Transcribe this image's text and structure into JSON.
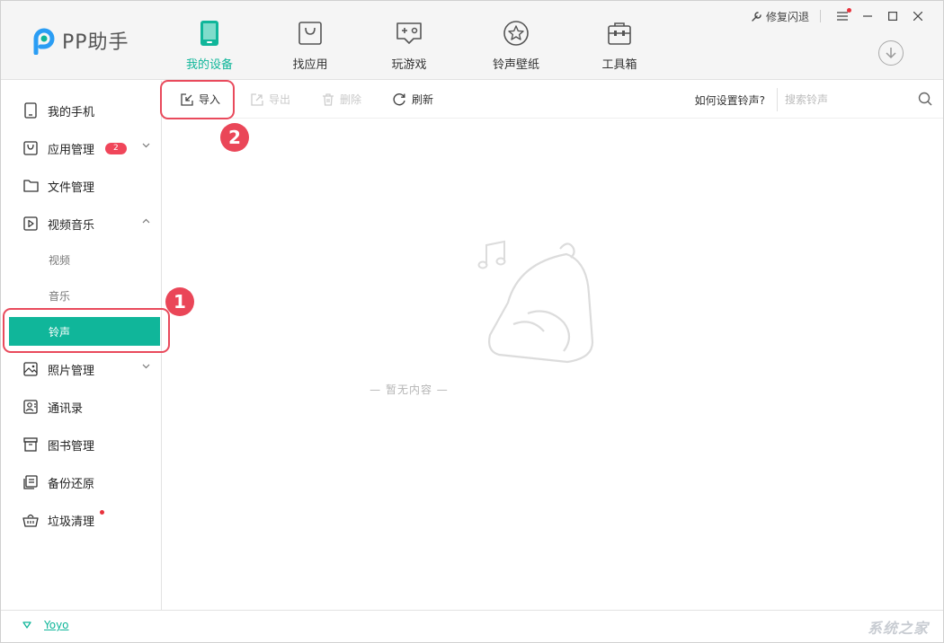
{
  "app": {
    "logo_text": "PP助手",
    "accent_color": "#10b69a"
  },
  "nav": {
    "items": [
      {
        "label": "我的设备",
        "icon": "phone-icon",
        "active": true
      },
      {
        "label": "找应用",
        "icon": "shopping-bag-icon",
        "active": false
      },
      {
        "label": "玩游戏",
        "icon": "gamepad-icon",
        "active": false
      },
      {
        "label": "铃声壁纸",
        "icon": "star-icon",
        "active": false
      },
      {
        "label": "工具箱",
        "icon": "toolbox-icon",
        "active": false
      }
    ]
  },
  "window": {
    "repair_label": "修复闪退"
  },
  "sidebar": {
    "items": [
      {
        "label": "我的手机",
        "icon": "phone-outline-icon"
      },
      {
        "label": "应用管理",
        "icon": "bag-outline-icon",
        "badge": "2"
      },
      {
        "label": "文件管理",
        "icon": "folder-icon"
      },
      {
        "label": "视频音乐",
        "icon": "play-icon"
      },
      {
        "label": "照片管理",
        "icon": "image-icon"
      },
      {
        "label": "通讯录",
        "icon": "contacts-icon"
      },
      {
        "label": "图书管理",
        "icon": "book-icon"
      },
      {
        "label": "备份还原",
        "icon": "backup-icon"
      },
      {
        "label": "垃圾清理",
        "icon": "basket-icon"
      }
    ],
    "sub_items": [
      {
        "label": "视频"
      },
      {
        "label": "音乐"
      },
      {
        "label": "铃声",
        "active": true
      }
    ]
  },
  "toolbar": {
    "import_label": "导入",
    "export_label": "导出",
    "delete_label": "删除",
    "refresh_label": "刷新",
    "help_label": "如何设置铃声?",
    "search_placeholder": "搜索铃声"
  },
  "content": {
    "empty_text": "— 暂无内容 —"
  },
  "footer": {
    "device_name": "Yoyo",
    "watermark": "系统之家"
  },
  "annotations": {
    "step1": "1",
    "step2": "2",
    "color": "#e94a5c"
  }
}
